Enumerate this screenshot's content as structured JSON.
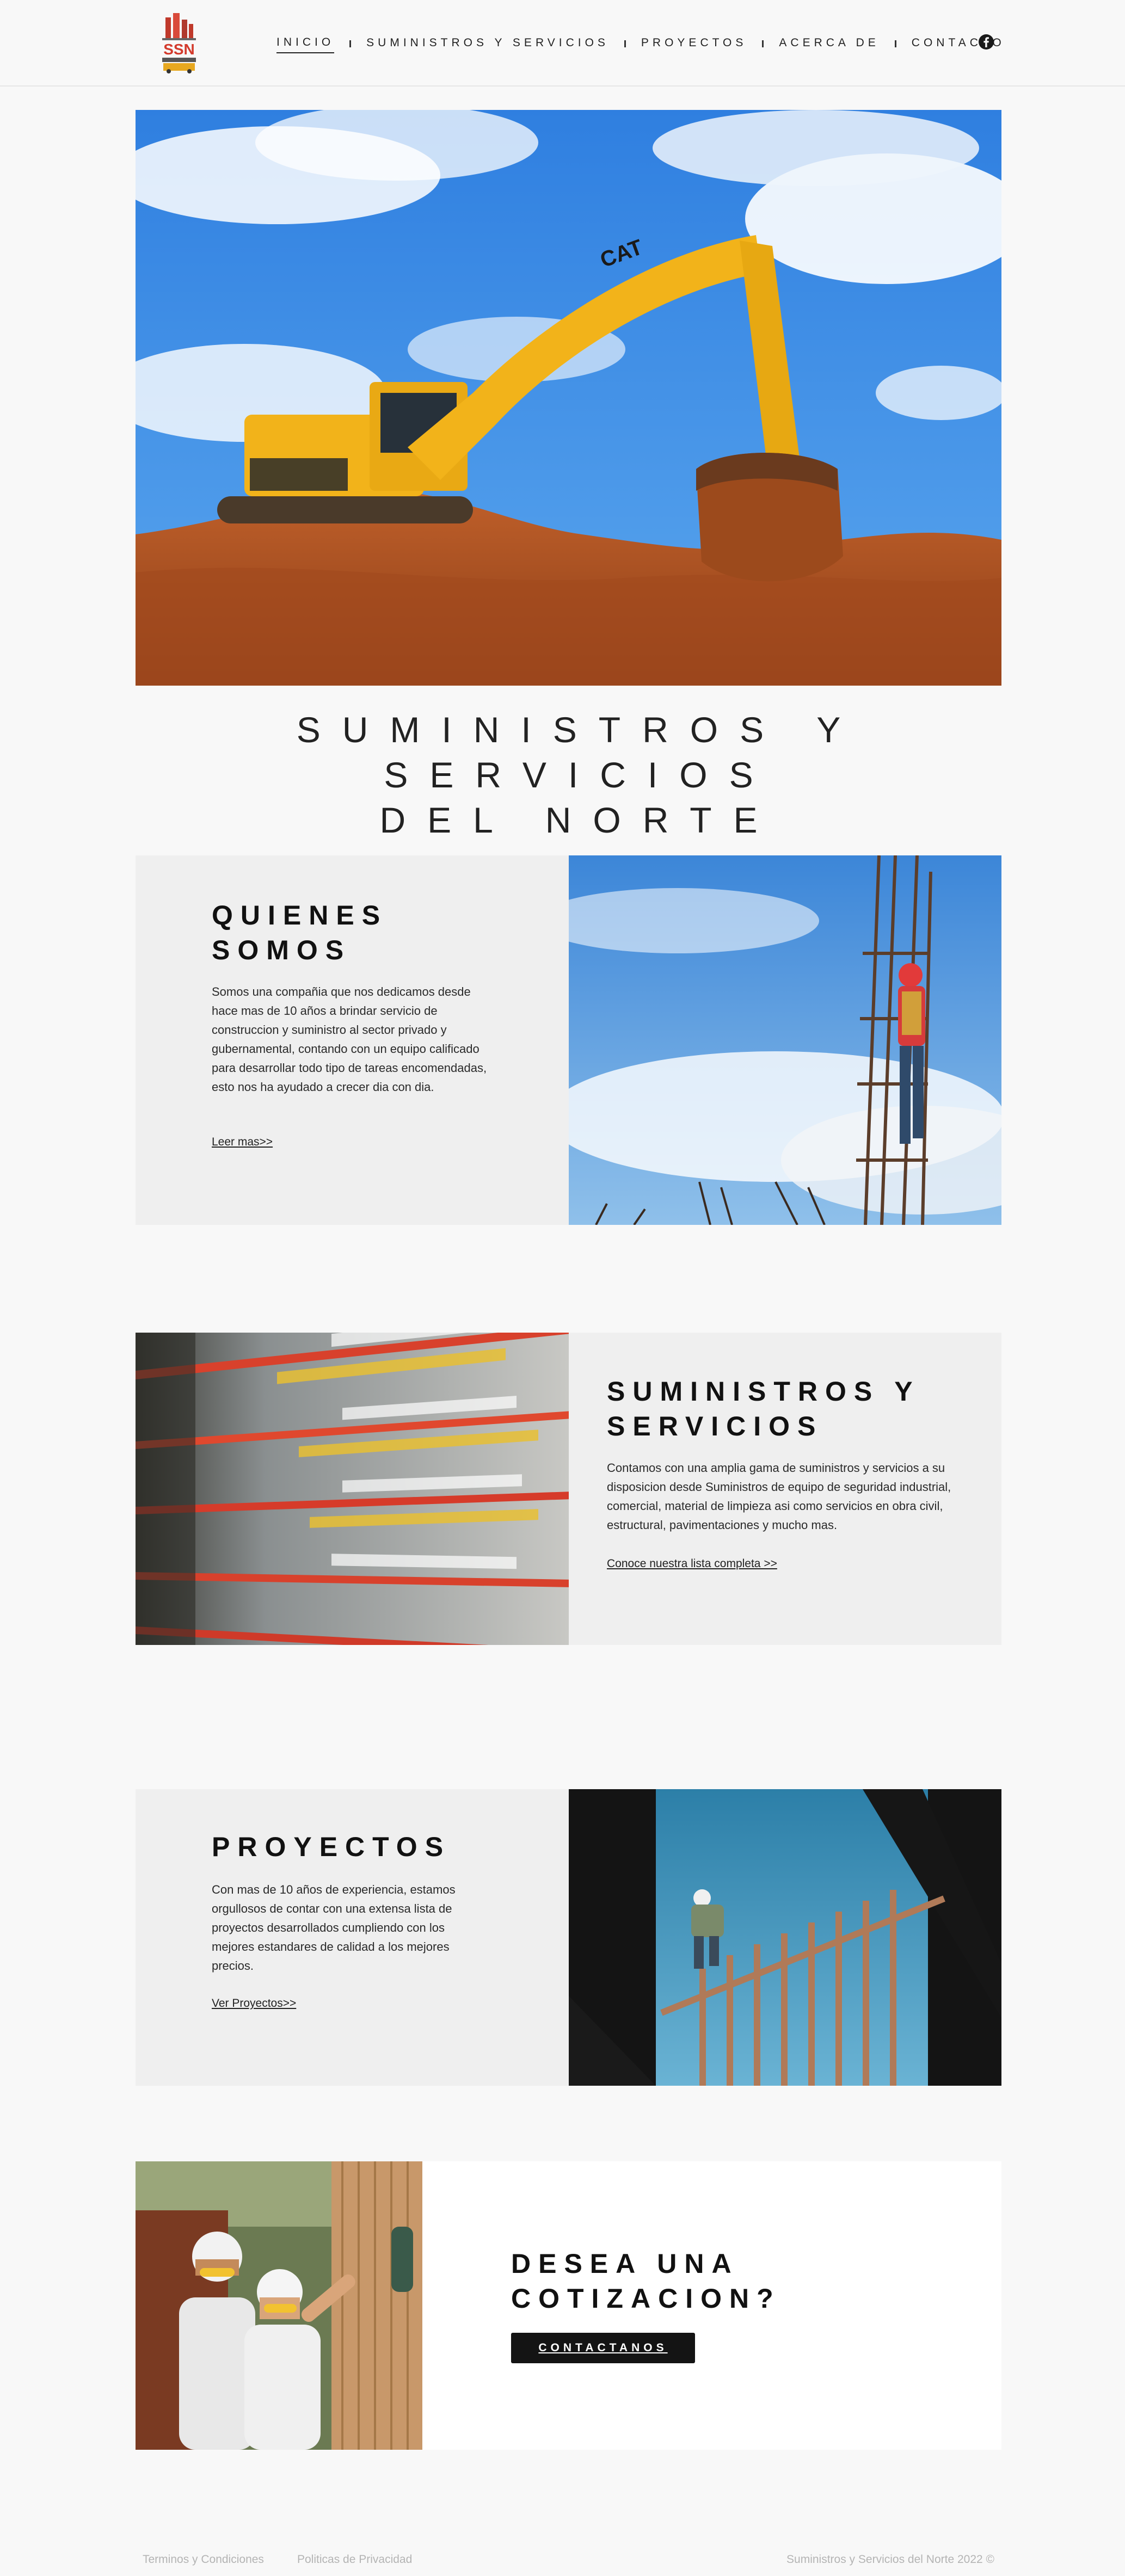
{
  "header": {
    "logo_text": "SSN",
    "nav": [
      {
        "label": "INICIO",
        "active": true
      },
      {
        "label": "SUMINISTROS Y SERVICIOS",
        "active": false
      },
      {
        "label": "PROYECTOS",
        "active": false
      },
      {
        "label": "ACERCA DE",
        "active": false
      },
      {
        "label": "CONTACTO",
        "active": false
      }
    ],
    "social_icon": "facebook-icon"
  },
  "hero": {
    "title_line1": "SUMINISTROS Y SERVICIOS",
    "title_line2": "DEL NORTE",
    "image": "yellow-excavator-on-dirt-mound"
  },
  "quienes": {
    "heading_line1": "QUIENES",
    "heading_line2": "SOMOS",
    "text": "Somos una compañia que nos dedicamos desde hace mas de 10 años a brindar servicio de construccion y suministro al sector privado y gubernamental, contando con un equipo calificado para desarrollar todo tipo de tareas encomendadas, esto nos ha ayudado a crecer dia con dia.",
    "link": "Leer mas>>",
    "image": "worker-climbing-rebar-tower"
  },
  "suministros": {
    "heading_line1": "SUMINISTROS Y",
    "heading_line2": "SERVICIOS",
    "text": "Contamos con una amplia gama de suministros y servicios a su disposicion desde Suministros de equipo de seguridad industrial, comercial, material de limpieza asi como servicios en obra civil, estructural, pavimentaciones y mucho mas.",
    "link": "Conoce nuestra lista completa >>",
    "image": "hardware-store-shelves"
  },
  "proyectos": {
    "heading": "PROYECTOS",
    "text": "Con mas de 10 años de experiencia, estamos orgullosos de contar con una extensa lista de proyectos desarrollados cumpliendo con los mejores estandares de calidad a los mejores precios.",
    "link": "Ver Proyectos>>",
    "image": "worker-on-wood-framing"
  },
  "cta": {
    "heading_line1": "DESEA UNA",
    "heading_line2": "COTIZACION?",
    "button": "CONTACTANOS",
    "image": "two-workers-with-hard-hats"
  },
  "footer": {
    "terms": "Terminos y Condiciones",
    "privacy": "Politicas de Privacidad",
    "copyright": "Suministros y Servicios del Norte 2022 ©"
  },
  "colors": {
    "background": "#f8f8f8",
    "panel": "#efefef",
    "button": "#141414",
    "footer_text": "#b4b4b4"
  }
}
